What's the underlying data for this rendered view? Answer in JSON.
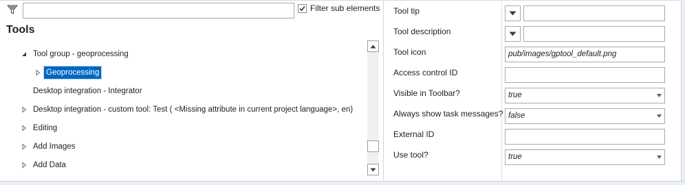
{
  "filter": {
    "icon": "filter-icon",
    "value": "",
    "checkbox_checked": true,
    "checkbox_label": "Filter sub elements"
  },
  "tree": {
    "title": "Tools",
    "items": [
      {
        "label": "Tool group - geoprocessing",
        "expander": "expanded"
      },
      {
        "label": "Geoprocessing",
        "expander": "collapsed",
        "selected": true
      },
      {
        "label": "Desktop integration - Integrator",
        "expander": "none"
      },
      {
        "label": "Desktop integration - custom tool: Test ( <Missing attribute in current project language>, en)",
        "expander": "collapsed"
      },
      {
        "label": "Editing",
        "expander": "collapsed"
      },
      {
        "label": "Add Images",
        "expander": "collapsed"
      },
      {
        "label": "Add Data",
        "expander": "collapsed"
      }
    ]
  },
  "properties": {
    "tool_tip": {
      "label": "Tool tip",
      "value": ""
    },
    "tool_description": {
      "label": "Tool description",
      "value": ""
    },
    "tool_icon": {
      "label": "Tool icon",
      "value": "pub/images/gptool_default.png"
    },
    "access_control_id": {
      "label": "Access control ID",
      "value": ""
    },
    "visible_in_toolbar": {
      "label": "Visible in Toolbar?",
      "value": "true"
    },
    "always_show_task_messages": {
      "label": "Always show task messages?",
      "value": "false"
    },
    "external_id": {
      "label": "External ID",
      "value": ""
    },
    "use_tool": {
      "label": "Use tool?",
      "value": "true"
    }
  },
  "colors": {
    "selection": "#0067c0",
    "border": "#a9a9a9"
  }
}
